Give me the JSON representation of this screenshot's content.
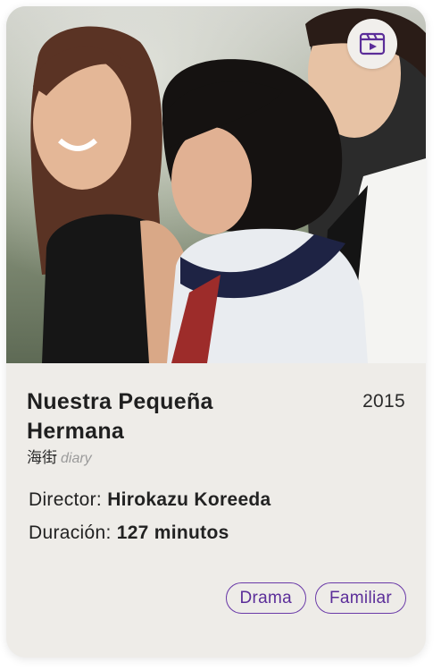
{
  "movie": {
    "title": "Nuestra Pequeña Hermana",
    "year": "2015",
    "alt_title_cjk": "海街",
    "alt_title_latin": "diary",
    "director_label": "Director:",
    "director": "Hirokazu Koreeda",
    "duration_label": "Duración:",
    "duration": "127 minutos",
    "tags": [
      "Drama",
      "Familiar"
    ]
  },
  "icons": {
    "media_badge": "film-play-icon"
  },
  "colors": {
    "accent": "#5b2d99",
    "card_bg": "#eeece8"
  }
}
